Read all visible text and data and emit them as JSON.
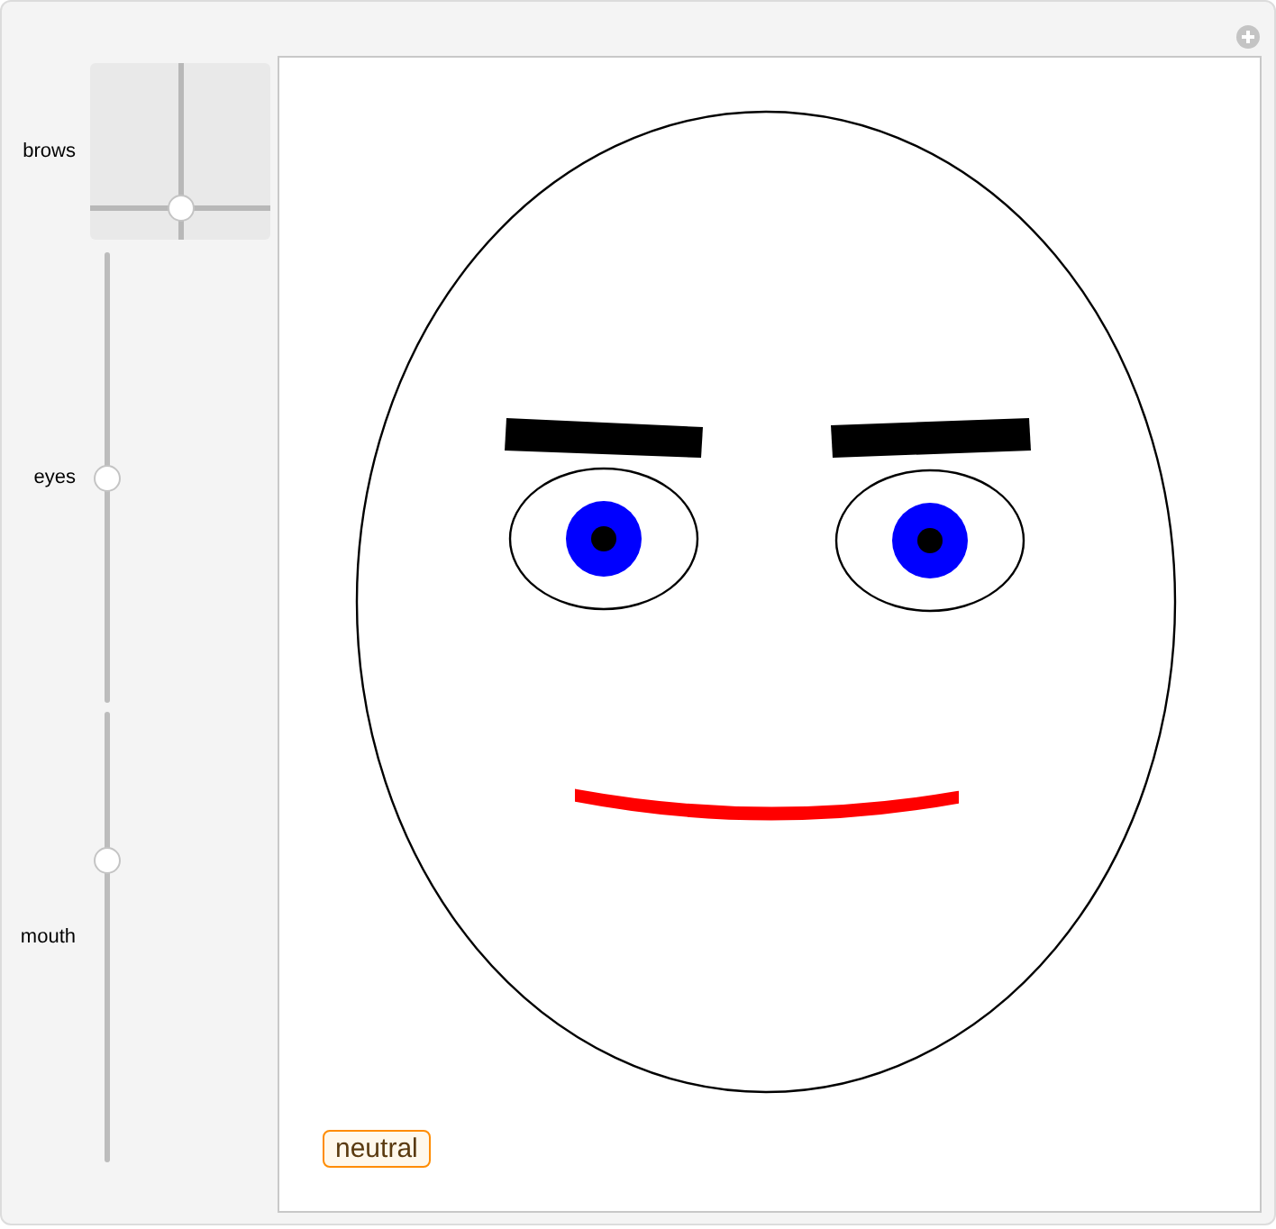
{
  "controls": [
    {
      "kind": "pad",
      "label": "brows",
      "horizontal": {
        "level": 0.5
      },
      "vertical": {
        "level": 0.12
      }
    },
    {
      "kind": "slider",
      "label": "eyes",
      "level": 0.5
    },
    {
      "kind": "slider",
      "label": "mouth",
      "level": 0.68
    }
  ],
  "expression": "neutral"
}
